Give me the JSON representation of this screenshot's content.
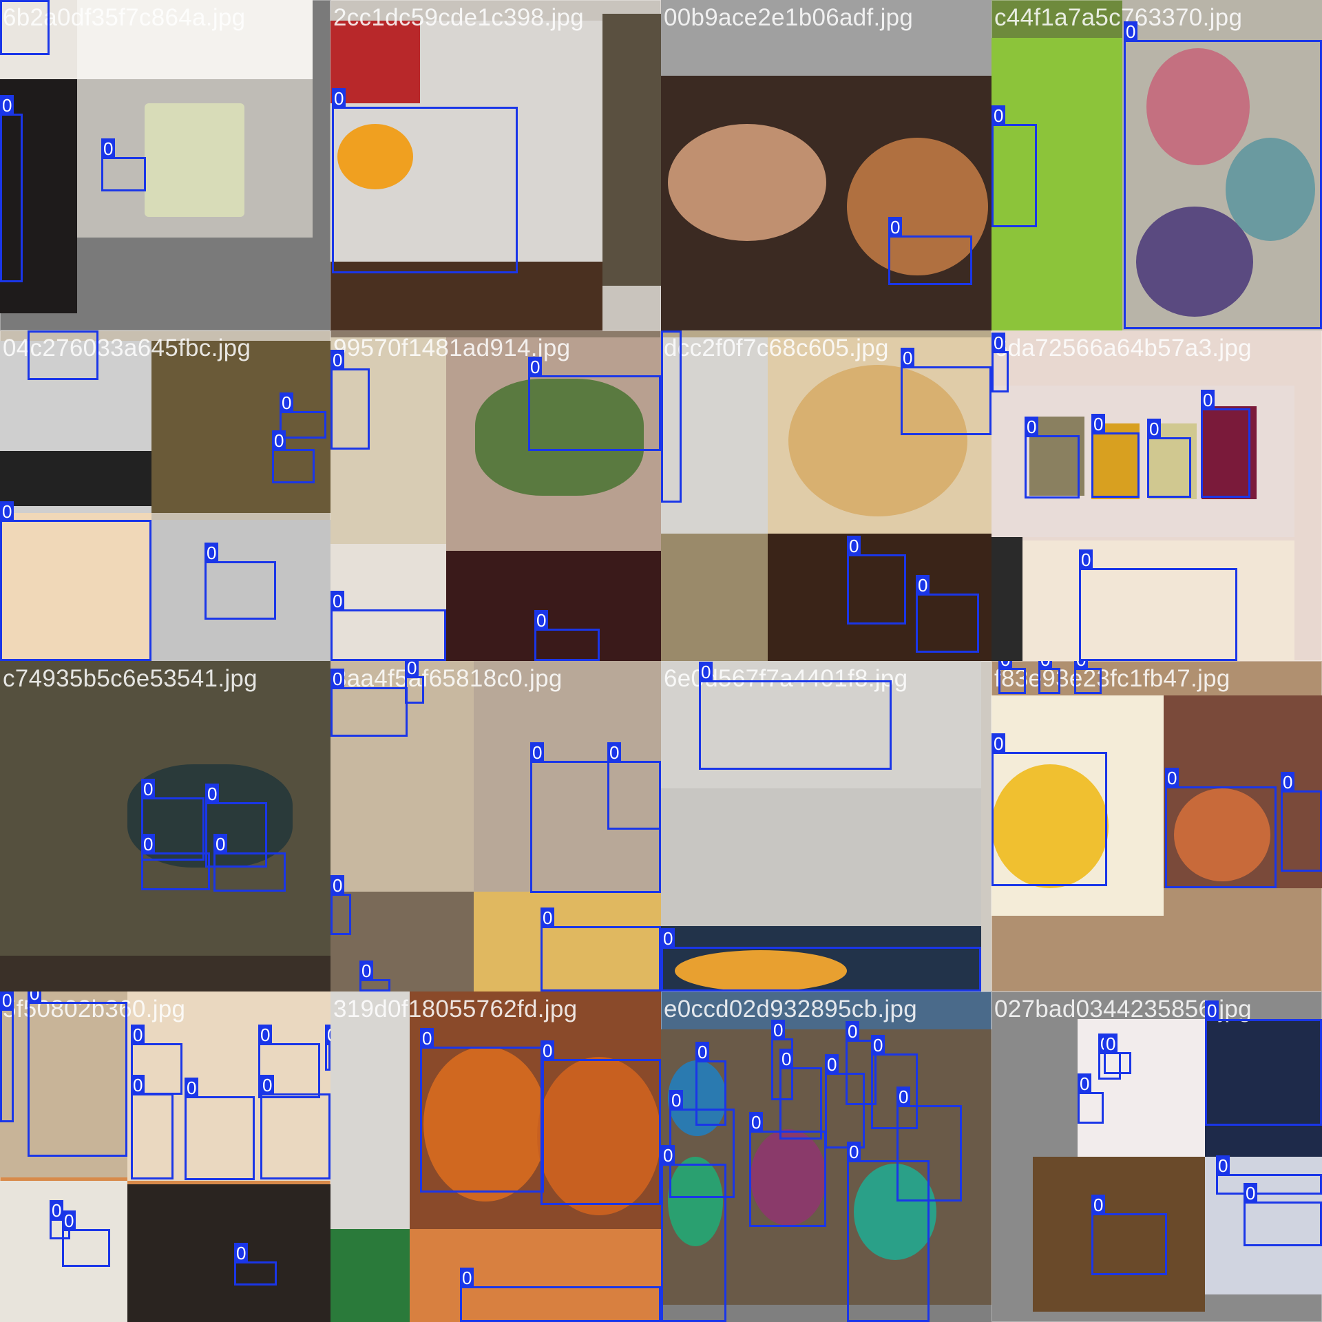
{
  "grid": {
    "class_label": "0",
    "box_color": "#1a36e8",
    "tiles": [
      {
        "name": "6b2a0df35f7c864a.jpg",
        "bg": "#7a7a7a"
      },
      {
        "name": "2cc1dc59cde1c398.jpg",
        "bg": "#c9c4bd"
      },
      {
        "name": "00b9ace2e1b06adf.jpg",
        "bg": "#3a2a22"
      },
      {
        "name": "c44f1a7a5c763370.jpg",
        "bg": "#6e8a3c"
      },
      {
        "name": "04c276033a645fbc.jpg",
        "bg": "#c8bfb0"
      },
      {
        "name": "99570f1481ad914.jpg",
        "bg": "#8c7b6a"
      },
      {
        "name": "dcc2f0f7c68c605.jpg",
        "bg": "#b8a98a"
      },
      {
        "name": "6da72566a64b57a3.jpg",
        "bg": "#e8d8d0"
      },
      {
        "name": "c74935b5c6e53541.jpg",
        "bg": "#4a4535"
      },
      {
        "name": "3aa4f5af65818c0.jpg",
        "bg": "#a89580"
      },
      {
        "name": "6e0d567f7a4401f8.jpg",
        "bg": "#cfcac2"
      },
      {
        "name": "f83e93e23fc1fb47.jpg",
        "bg": "#b09070"
      },
      {
        "name": "5f50802b360.jpg",
        "bg": "#d88a4a"
      },
      {
        "name": "319d0f18055762fd.jpg",
        "bg": "#c86a2e"
      },
      {
        "name": "e0ccd02d932895cb.jpg",
        "bg": "#4a6a8a"
      },
      {
        "name": "027bad0344235856.jpg",
        "bg": "#8a8a8a"
      }
    ]
  }
}
